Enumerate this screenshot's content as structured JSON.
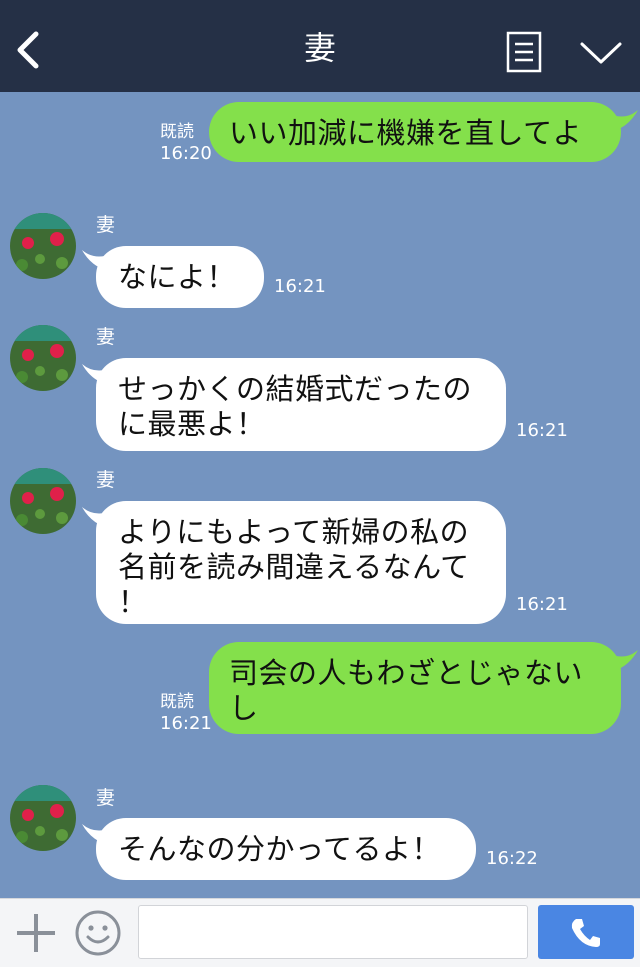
{
  "header": {
    "title": "妻",
    "back_icon": "chevron-left-icon",
    "menu_icon": "list-menu-icon",
    "toggle_icon": "chevron-down-icon"
  },
  "messages": [
    {
      "from": "me",
      "lines": [
        "いい加減に機嫌を直してよ"
      ],
      "read_label": "既読",
      "time": "16:20"
    },
    {
      "from": "them",
      "sender": "妻",
      "lines": [
        "なによ！"
      ],
      "time": "16:21"
    },
    {
      "from": "them",
      "sender": "妻",
      "lines": [
        "せっかくの結婚式だったの",
        "に最悪よ！"
      ],
      "time": "16:21"
    },
    {
      "from": "them",
      "sender": "妻",
      "lines": [
        "よりにもよって新婦の私の",
        "名前を読み間違えるなんて",
        "！"
      ],
      "time": "16:21"
    },
    {
      "from": "me",
      "lines": [
        "司会の人もわざとじゃない",
        "し"
      ],
      "read_label": "既読",
      "time": "16:21"
    },
    {
      "from": "them",
      "sender": "妻",
      "lines": [
        "そんなの分かってるよ！"
      ],
      "time": "16:22"
    }
  ],
  "footer": {
    "plus_icon": "plus-icon",
    "emoji_icon": "smiley-icon",
    "input_value": "",
    "call_icon": "phone-icon"
  },
  "colors": {
    "background": "#7494c0",
    "header": "#253046",
    "my_bubble": "#84e04b",
    "their_bubble": "#ffffff",
    "call_button": "#4a86e3"
  }
}
